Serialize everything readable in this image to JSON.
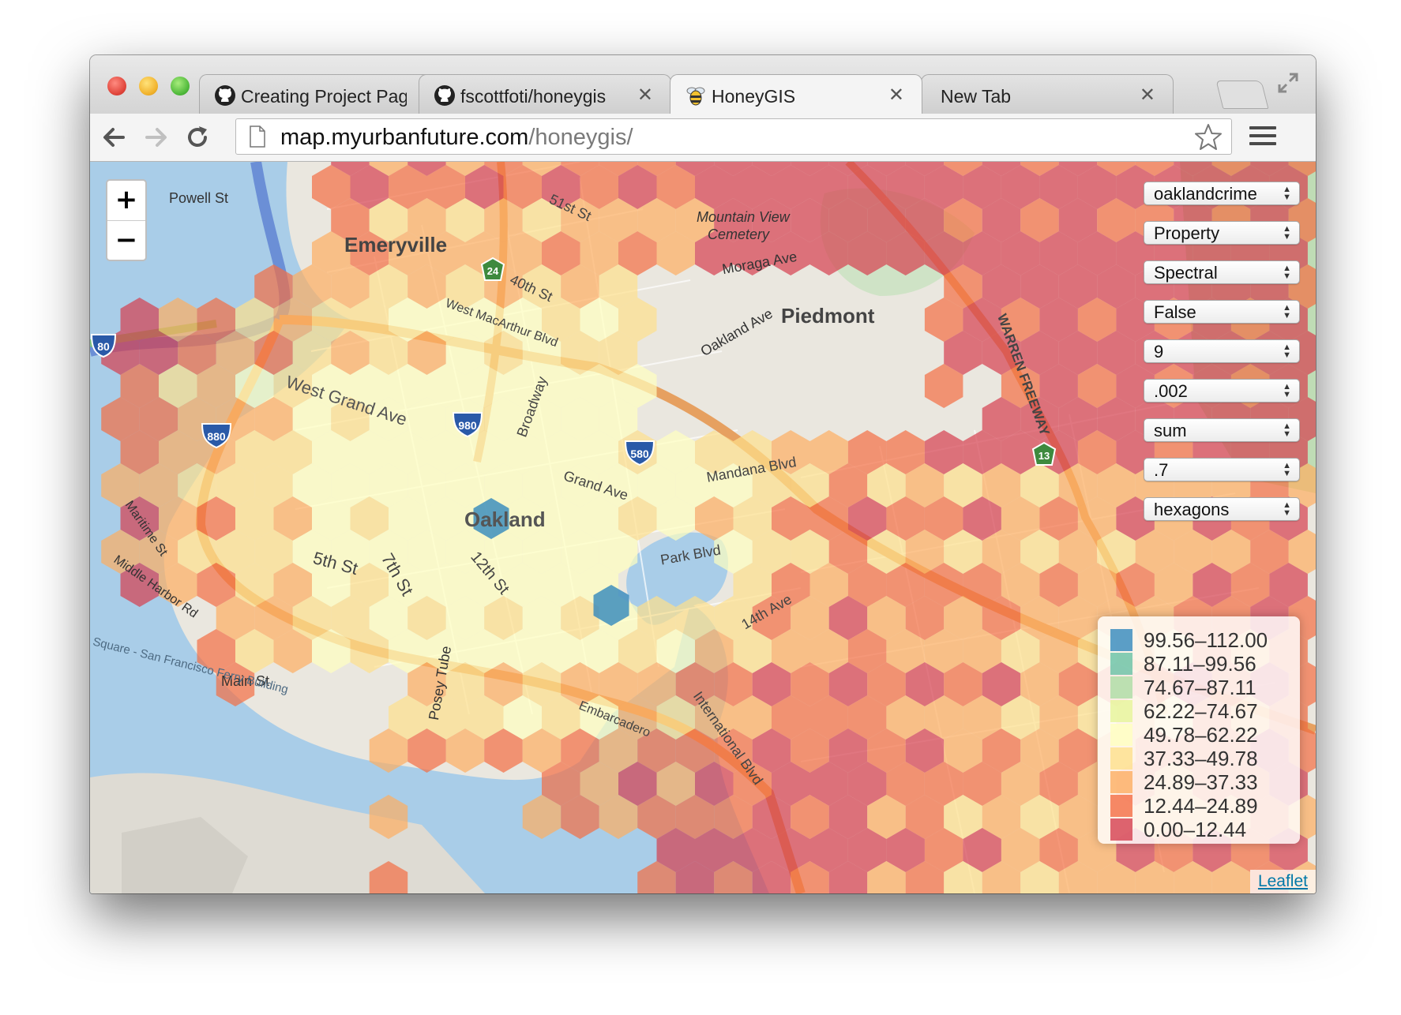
{
  "browser": {
    "tabs": [
      {
        "title": "Creating Project Pag",
        "icon": "github-icon",
        "close": "✕"
      },
      {
        "title": "fscottfoti/honeygis",
        "icon": "github-icon",
        "close": "✕"
      },
      {
        "title": "HoneyGIS",
        "icon": "bee-icon",
        "close": "✕"
      },
      {
        "title": "New Tab",
        "icon": "",
        "close": "✕"
      }
    ],
    "active_tab": 2,
    "url_host": "map.myurbanfuture.com",
    "url_path": "/honeygis/"
  },
  "map": {
    "zoom_in": "+",
    "zoom_out": "−",
    "controls": [
      {
        "name": "dataset-select",
        "value": "oaklandcrime"
      },
      {
        "name": "category-select",
        "value": "Property"
      },
      {
        "name": "colorscheme-select",
        "value": "Spectral"
      },
      {
        "name": "reverse-select",
        "value": "False"
      },
      {
        "name": "classes-select",
        "value": "9"
      },
      {
        "name": "cellsize-select",
        "value": ".002"
      },
      {
        "name": "aggregation-select",
        "value": "sum"
      },
      {
        "name": "opacity-select",
        "value": ".7"
      },
      {
        "name": "shape-select",
        "value": "hexagons"
      }
    ],
    "legend": [
      {
        "label": "99.56–112.00",
        "color": "#3288bd"
      },
      {
        "label": "87.11–99.56",
        "color": "#66c2a5"
      },
      {
        "label": "74.67–87.11",
        "color": "#abdda4"
      },
      {
        "label": "62.22–74.67",
        "color": "#e6f598"
      },
      {
        "label": "49.78–62.22",
        "color": "#ffffbf"
      },
      {
        "label": "37.33–49.78",
        "color": "#fee08b"
      },
      {
        "label": "24.89–37.33",
        "color": "#fdae61"
      },
      {
        "label": "12.44–24.89",
        "color": "#f46d43"
      },
      {
        "label": "0.00–12.44",
        "color": "#d53e4f"
      }
    ],
    "attribution": "Leaflet",
    "place_labels": {
      "emeryville": "Emeryville",
      "piedmont": "Piedmont",
      "oakland": "Oakland",
      "mountain_view": "Mountain View",
      "cemetery": "Cemetery",
      "powell": "Powell St",
      "west_grand": "West Grand Ave",
      "mandana": "Mandana Blvd",
      "park_blvd": "Park Blvd",
      "main_st": "Main St",
      "moraga": "Moraga Ave",
      "oakland_ave": "Oakland Ave",
      "warren": "WARREN FREEWAY",
      "intl": "International Blvd",
      "fifth": "5th St",
      "seventh": "7th St",
      "twelfth": "12th St",
      "fortieth": "40th St",
      "fiftyfirst": "51st St",
      "broadway": "Broadway",
      "grand": "Grand Ave",
      "fourteenth": "14th Ave",
      "ferry": "Square - San Francisco Ferry Building",
      "middle_harbor": "Middle Harbor Rd",
      "maritime": "Maritime St",
      "posey": "Posey Tube",
      "west_mac": "West MacArthur Blvd",
      "embarcadero": "Embarcadero"
    },
    "shields": {
      "i80": "80",
      "i880": "880",
      "i980": "980",
      "i580": "580",
      "r24": "24",
      "r13": "13"
    }
  }
}
